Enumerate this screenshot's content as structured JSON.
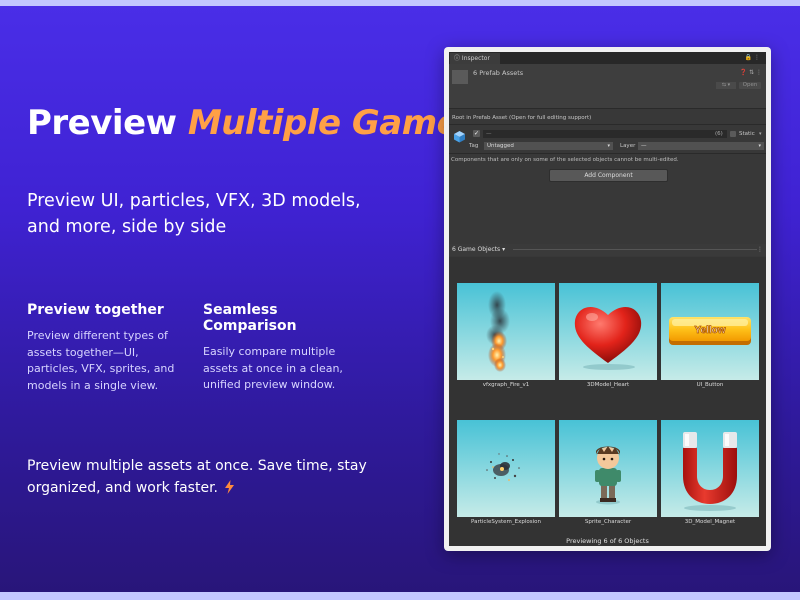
{
  "hero": {
    "title_plain": "Preview ",
    "title_accent": "Multiple Gameobjects",
    "subtitle": "Preview UI, particles, VFX, 3D models, and more, side by side"
  },
  "features": [
    {
      "title": "Preview together",
      "body": "Preview different types of assets together—UI, particles, VFX, sprites, and models in a single view."
    },
    {
      "title": "Seamless Comparison",
      "body": "Easily compare multiple assets at once in a clean, unified preview window."
    }
  ],
  "tagline": "Preview multiple assets at once. Save time, stay organized, and work faster.",
  "colors": {
    "accent": "#ffa046",
    "background": "#3f22d2",
    "inspector_bg": "#383838"
  },
  "inspector": {
    "tab_label": "Inspector",
    "tab_icons": "🔒 ⋮",
    "header_title": "6 Prefab Assets",
    "header_icons": "❓ ⇅ ⋮",
    "mini_dropdown": "⇆ ▾",
    "open_button": "Open",
    "root_note": "Root in Prefab Asset (Open for full editing support)",
    "active_check": "✓",
    "name_field": "—",
    "object_count": "(6)",
    "static_label": "Static",
    "tag_label": "Tag",
    "tag_value": "Untagged",
    "layer_label": "Layer",
    "layer_value": "—",
    "multi_edit_note": "Components that are only on some of the selected objects cannot be multi-edited.",
    "add_component": "Add Component",
    "game_objects_label": "6 Game Objects ▾",
    "menu_icon": "⋮",
    "items": [
      {
        "name": "vfxgraph_Fire_v1",
        "icon": "fire-vfx-preview"
      },
      {
        "name": "3DModel_Heart",
        "icon": "heart-model-preview"
      },
      {
        "name": "UI_Button",
        "icon": "ui-button-preview",
        "button_text": "Yellow"
      },
      {
        "name": "ParticleSystem_Explosion",
        "icon": "explosion-particles-preview"
      },
      {
        "name": "Sprite_Character",
        "icon": "character-sprite-preview"
      },
      {
        "name": "3D_Model_Magnet",
        "icon": "magnet-model-preview"
      }
    ],
    "footer": "Previewing 6 of 6 Objects"
  }
}
